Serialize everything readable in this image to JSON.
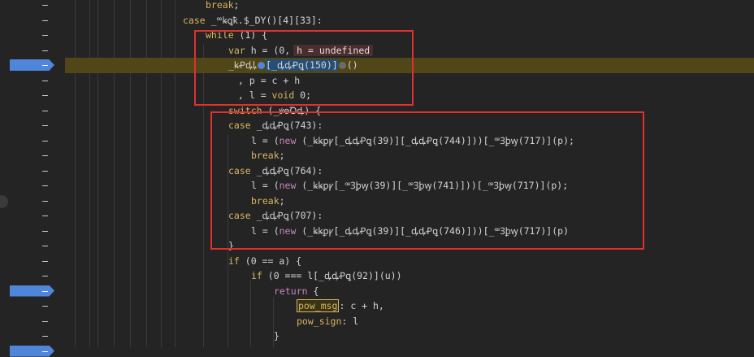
{
  "gutter": {
    "breakpoint_rows": [
      4,
      19,
      23
    ]
  },
  "code_lines": [
    {
      "id": "l0",
      "indent": "",
      "segments": [
        {
          "t": "break",
          "c": "kw"
        },
        {
          "t": ";",
          "c": "id"
        }
      ]
    },
    {
      "id": "l1",
      "segments": [
        {
          "t": "case ",
          "c": "kw"
        },
        {
          "t": "_ꟹꝃꝗꝁ.$_DY",
          "c": "id"
        },
        {
          "t": "()[4][33]:",
          "c": "id"
        }
      ]
    },
    {
      "id": "l2",
      "segments": [
        {
          "t": "while",
          "c": "kw"
        },
        {
          "t": " (1) {",
          "c": "id"
        }
      ]
    },
    {
      "id": "l3",
      "segments": [
        {
          "t": "var",
          "c": "kw"
        },
        {
          "t": " h = (0,",
          "c": "id"
        }
      ]
    },
    {
      "id": "l4",
      "segments": [
        {
          "t": "_ꝃꝒꝱꝲ",
          "c": "id"
        }
      ]
    },
    {
      "id": "l5",
      "segments": [
        {
          "t": ", p = c + h",
          "c": "id"
        }
      ]
    },
    {
      "id": "l6",
      "segments": [
        {
          "t": ", l = ",
          "c": "id"
        },
        {
          "t": "void",
          "c": "kw"
        },
        {
          "t": " 0;",
          "c": "id"
        }
      ]
    },
    {
      "id": "l7",
      "segments": [
        {
          "t": "switch",
          "c": "kw"
        },
        {
          "t": " (_ꝟꝋꝹꝱ) {",
          "c": "id"
        }
      ]
    },
    {
      "id": "l8",
      "segments": [
        {
          "t": "case",
          "c": "kw"
        },
        {
          "t": " _ꝱꝱꝒꝗ(743):",
          "c": "id"
        }
      ]
    },
    {
      "id": "l9",
      "segments": [
        {
          "t": "l = (",
          "c": "id"
        },
        {
          "t": "new",
          "c": "kw2"
        },
        {
          "t": " (_ꝃꝃꝑꝩ[_ꝱꝱꝒꝗ(39)][_ꝱꝱꝒꝗ(744)]))[_ꟹꝪꝧꝡ(717)](p);",
          "c": "id"
        }
      ]
    },
    {
      "id": "l10",
      "segments": [
        {
          "t": "break",
          "c": "kw"
        },
        {
          "t": ";",
          "c": "id"
        }
      ]
    },
    {
      "id": "l11",
      "segments": [
        {
          "t": "case",
          "c": "kw"
        },
        {
          "t": " _ꝱꝱꝒꝗ(764):",
          "c": "id"
        }
      ]
    },
    {
      "id": "l12",
      "segments": [
        {
          "t": "l = (",
          "c": "id"
        },
        {
          "t": "new",
          "c": "kw2"
        },
        {
          "t": " (_ꝃꝃꝑꝩ[_ꟹꝪꝧꝡ(39)][_ꟹꝪꝧꝡ(741)]))[_ꟹꝪꝧꝡ(717)](p);",
          "c": "id"
        }
      ]
    },
    {
      "id": "l13",
      "segments": [
        {
          "t": "break",
          "c": "kw"
        },
        {
          "t": ";",
          "c": "id"
        }
      ]
    },
    {
      "id": "l14",
      "segments": [
        {
          "t": "case",
          "c": "kw"
        },
        {
          "t": " _ꝱꝱꝒꝗ(707):",
          "c": "id"
        }
      ]
    },
    {
      "id": "l15",
      "segments": [
        {
          "t": "l = (",
          "c": "id"
        },
        {
          "t": "new",
          "c": "kw2"
        },
        {
          "t": " (_ꝃꝃꝑꝩ[_ꝱꝱꝒꝗ(39)][_ꝱꝱꝒꝗ(746)]))[_ꟹꝪꝧꝡ(717)](p)",
          "c": "id"
        }
      ]
    },
    {
      "id": "l16",
      "segments": [
        {
          "t": "}",
          "c": "id"
        }
      ]
    },
    {
      "id": "l17",
      "segments": [
        {
          "t": "if",
          "c": "kw"
        },
        {
          "t": " (0 == a) {",
          "c": "id"
        }
      ]
    },
    {
      "id": "l18",
      "segments": [
        {
          "t": "if",
          "c": "kw"
        },
        {
          "t": " (0 === l[_ꝱꝱꝒꝗ(92)](u))",
          "c": "id"
        }
      ]
    },
    {
      "id": "l19",
      "segments": [
        {
          "t": "return",
          "c": "kw2"
        },
        {
          "t": " {",
          "c": "id"
        }
      ]
    },
    {
      "id": "l20",
      "segments": [
        {
          "t": ": c + h,",
          "c": "id"
        }
      ]
    },
    {
      "id": "l21",
      "segments": [
        {
          "t": "pow_sign",
          "c": "kw"
        },
        {
          "t": ": l",
          "c": "id"
        }
      ]
    },
    {
      "id": "l22",
      "segments": [
        {
          "t": "}",
          "c": "id"
        }
      ]
    }
  ],
  "inline_value": "h = undefined",
  "paused_line": {
    "selected": "[_ꝱꝱꝒꝗ(150)]",
    "tail": "()"
  },
  "pow_msg_key": "pow_msg",
  "colors": {
    "keyword": "#d8b661",
    "control": "#c586c0",
    "highlight_line": "#514617",
    "annotation_box": "#e03030",
    "breakpoint": "#4f86d9"
  }
}
